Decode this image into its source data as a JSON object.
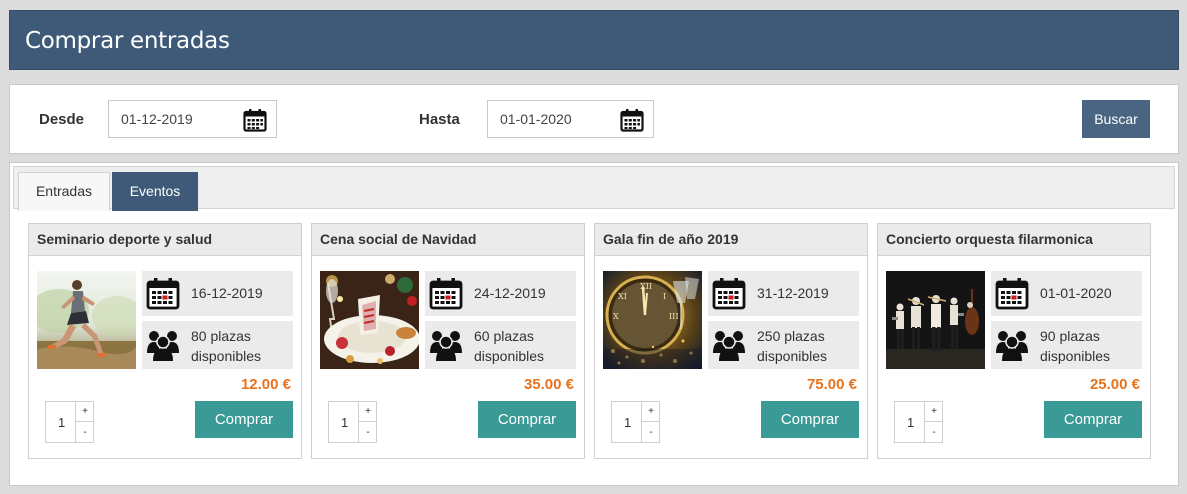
{
  "header": {
    "title": "Comprar entradas"
  },
  "filter": {
    "desde_label": "Desde",
    "desde_value": "01-12-2019",
    "hasta_label": "Hasta",
    "hasta_value": "01-01-2020",
    "search_label": "Buscar"
  },
  "tabs": [
    {
      "label": "Entradas",
      "active": false
    },
    {
      "label": "Eventos",
      "active": true
    }
  ],
  "events": [
    {
      "title": "Seminario deporte y salud",
      "date": "16-12-2019",
      "seats_line1": "80 plazas",
      "seats_line2": "disponibles",
      "price": "12.00 €",
      "qty": "1",
      "buy_label": "Comprar",
      "qty_plus": "+",
      "qty_minus": "-",
      "image": "runner-photo"
    },
    {
      "title": "Cena social de Navidad",
      "date": "24-12-2019",
      "seats_line1": "60 plazas",
      "seats_line2": "disponibles",
      "price": "35.00 €",
      "qty": "1",
      "buy_label": "Comprar",
      "qty_plus": "+",
      "qty_minus": "-",
      "image": "christmas-dinner-photo"
    },
    {
      "title": "Gala fin de año 2019",
      "date": "31-12-2019",
      "seats_line1": "250 plazas",
      "seats_line2": "disponibles",
      "price": "75.00 €",
      "qty": "1",
      "buy_label": "Comprar",
      "qty_plus": "+",
      "qty_minus": "-",
      "image": "clock-champagne-photo"
    },
    {
      "title": "Concierto orquesta filarmonica",
      "date": "01-01-2020",
      "seats_line1": "90 plazas",
      "seats_line2": "disponibles",
      "price": "25.00 €",
      "qty": "1",
      "buy_label": "Comprar",
      "qty_plus": "+",
      "qty_minus": "-",
      "image": "orchestra-photo"
    }
  ],
  "colors": {
    "header_bg": "#3e5a78",
    "search_button": "#4a6582",
    "buy_button": "#3a9a96",
    "price": "#e8731c"
  }
}
